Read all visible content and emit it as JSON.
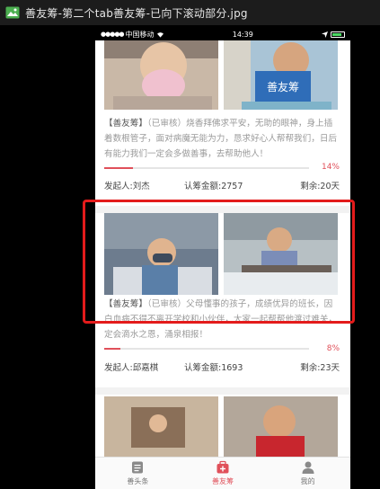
{
  "window": {
    "title": "善友筹-第二个tab善友筹-已向下滚动部分.jpg"
  },
  "status_bar": {
    "carrier": "中国移动",
    "wifi": "wifi-icon",
    "time": "14:39",
    "battery": "battery-icon"
  },
  "cards": [
    {
      "photo_left": "girl-with-mask-photo",
      "photo_right": "boy-with-sign-photo",
      "sign_text": "善友筹",
      "tag": "【善友筹】",
      "description": "（已审核）烧香拜佛求平安，无助的眼神，身上插着数根管子，面对病魔无能为力，恳求好心人帮帮我们，日后有能力我们一定会多做善事，去帮助他人！",
      "progress_percent": 14,
      "progress_label": "14%",
      "initiator": "发起人:刘杰",
      "amount": "认筹金额:2757",
      "remaining": "剩余:20天"
    },
    {
      "photo_left": "boy-in-hospital-bed-photo",
      "photo_right": "boy-studying-photo",
      "tag": "【善友筹】",
      "description": "（已审核）父母懂事的孩子，成绩优异的班长，因白血病不得不离开学校和小伙伴，大家一起帮帮他渡过难关，定会滴水之恩，涌泉相报！",
      "progress_percent": 8,
      "progress_label": "8%",
      "initiator": "发起人:邱嘉棋",
      "amount": "认筹金额:1693",
      "remaining": "剩余:23天"
    },
    {
      "photo_left": "child-photo",
      "photo_right": "boy-in-red-photo"
    }
  ],
  "tabbar": {
    "tabs": [
      {
        "label": "善头条",
        "icon": "news-icon",
        "active": false
      },
      {
        "label": "善友筹",
        "icon": "donation-box-icon",
        "active": true
      },
      {
        "label": "我的",
        "icon": "person-icon",
        "active": false
      }
    ]
  },
  "colors": {
    "accent": "#e0505a",
    "highlight": "#e31b1b"
  }
}
